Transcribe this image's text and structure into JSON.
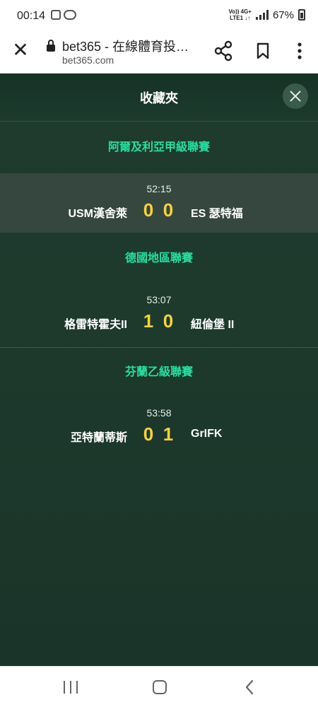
{
  "status_bar": {
    "time": "00:14",
    "network_top": "Vo)) 4G+",
    "network_bottom": "LTE1 ↓↑",
    "battery": "67%"
  },
  "browser": {
    "title": "bet365 - 在線體育投…",
    "url": "bet365.com",
    "icons": [
      "close-icon",
      "lock-icon",
      "share-icon",
      "bookmark-icon",
      "more-vert-icon"
    ]
  },
  "favorites": {
    "title": "收藏夾",
    "leagues": [
      {
        "name": "阿爾及利亞甲級聯賽",
        "match": {
          "time": "52:15",
          "home": "USM漢舍萊",
          "home_score": "0",
          "away_score": "0",
          "away": "ES 瑟特福"
        }
      },
      {
        "name": "德國地區聯賽",
        "match": {
          "time": "53:07",
          "home": "格雷特霍夫II",
          "home_score": "1",
          "away_score": "0",
          "away": "紐倫堡 II"
        }
      },
      {
        "name": "芬蘭乙級聯賽",
        "match": {
          "time": "53:58",
          "home": "亞特蘭蒂斯",
          "home_score": "0",
          "away_score": "1",
          "away": "GrIFK"
        }
      }
    ]
  },
  "colors": {
    "league": "#24e0a0",
    "score": "#f8d33a",
    "background": "#1d3a2d"
  }
}
